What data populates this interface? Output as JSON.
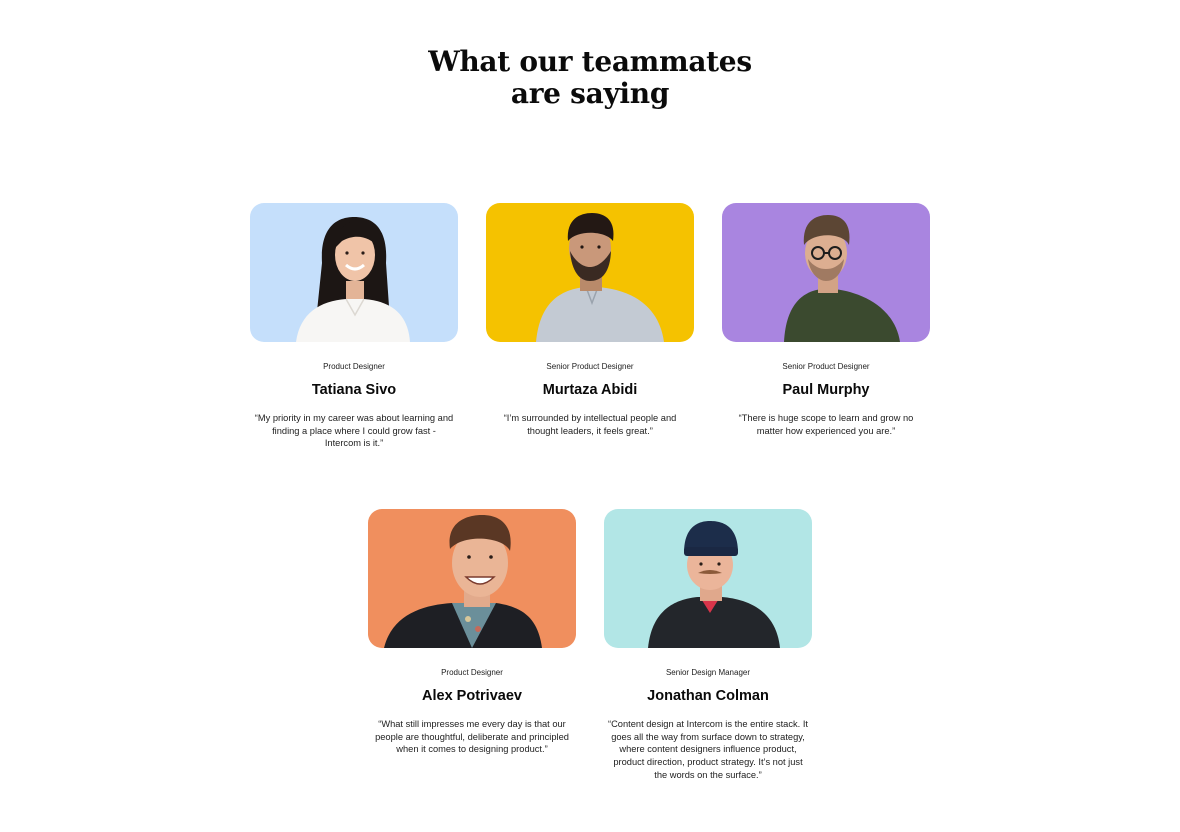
{
  "section": {
    "heading_line1": "What our teammates",
    "heading_line2": "are saying"
  },
  "teammates": [
    {
      "role": "Product Designer",
      "name": "Tatiana Sivo",
      "quote": "“My priority in my career was about learning and finding a place where I could grow fast - Intercom is it.”",
      "photo_bg": "#c5dffb"
    },
    {
      "role": "Senior Product Designer",
      "name": "Murtaza Abidi",
      "quote": "“I’m surrounded by intellectual people and thought leaders, it feels great.”",
      "photo_bg": "#f5c200"
    },
    {
      "role": "Senior Product Designer",
      "name": "Paul Murphy",
      "quote": "“There is huge scope to learn and grow no matter how experienced you are.”",
      "photo_bg": "#a985e0"
    },
    {
      "role": "Product Designer",
      "name": "Alex Potrivaev",
      "quote": "“What still impresses me every day is that our people are thoughtful, deliberate and principled when it comes to designing product.”",
      "photo_bg": "#f08f5e"
    },
    {
      "role": "Senior Design Manager",
      "name": "Jonathan Colman",
      "quote": "“Content design at Intercom is the entire stack. It goes all the way from surface down to strategy, where content designers influence product, product direction, product strategy. It’s not just the words on the surface.”",
      "photo_bg": "#b2e6e6"
    }
  ]
}
